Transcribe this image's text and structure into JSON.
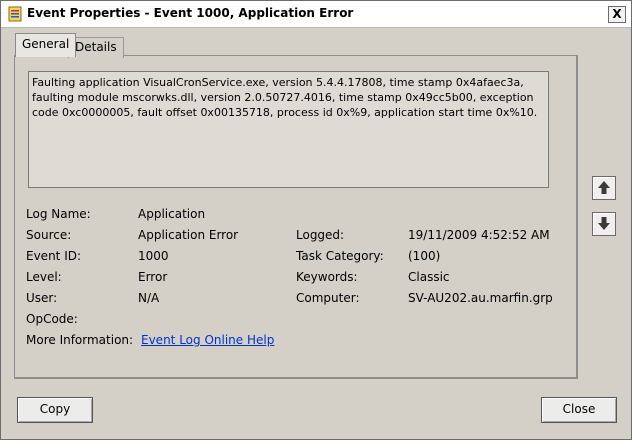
{
  "window": {
    "title": "Event Properties - Event 1000, Application Error",
    "close_glyph": "X"
  },
  "tabs": [
    {
      "label": "General",
      "active": true
    },
    {
      "label": "Details",
      "active": false
    }
  ],
  "description": "Faulting application VisualCronService.exe, version 5.4.4.17808, time stamp 0x4afaec3a, faulting module mscorwks.dll, version 2.0.50727.4016, time stamp 0x49cc5b00, exception code 0xc0000005, fault offset 0x00135718, process id 0x%9, application start time 0x%10.",
  "fields": {
    "log_name": {
      "label": "Log Name:",
      "value": "Application"
    },
    "source": {
      "label": "Source:",
      "value": "Application Error"
    },
    "logged": {
      "label": "Logged:",
      "value": "19/11/2009 4:52:52 AM"
    },
    "event_id": {
      "label": "Event ID:",
      "value": "1000"
    },
    "task_category": {
      "label": "Task Category:",
      "value": "(100)"
    },
    "level": {
      "label": "Level:",
      "value": "Error"
    },
    "keywords": {
      "label": "Keywords:",
      "value": "Classic"
    },
    "user": {
      "label": "User:",
      "value": "N/A"
    },
    "computer": {
      "label": "Computer:",
      "value": "SV-AU202.au.marfin.grp"
    },
    "opcode": {
      "label": "OpCode:",
      "value": ""
    },
    "more_info": {
      "label": "More Information:",
      "link": "Event Log Online Help"
    }
  },
  "buttons": {
    "copy": "Copy",
    "close": "Close"
  },
  "icons": {
    "title": "event-viewer-icon",
    "up": "arrow-up-icon",
    "down": "arrow-down-icon"
  }
}
